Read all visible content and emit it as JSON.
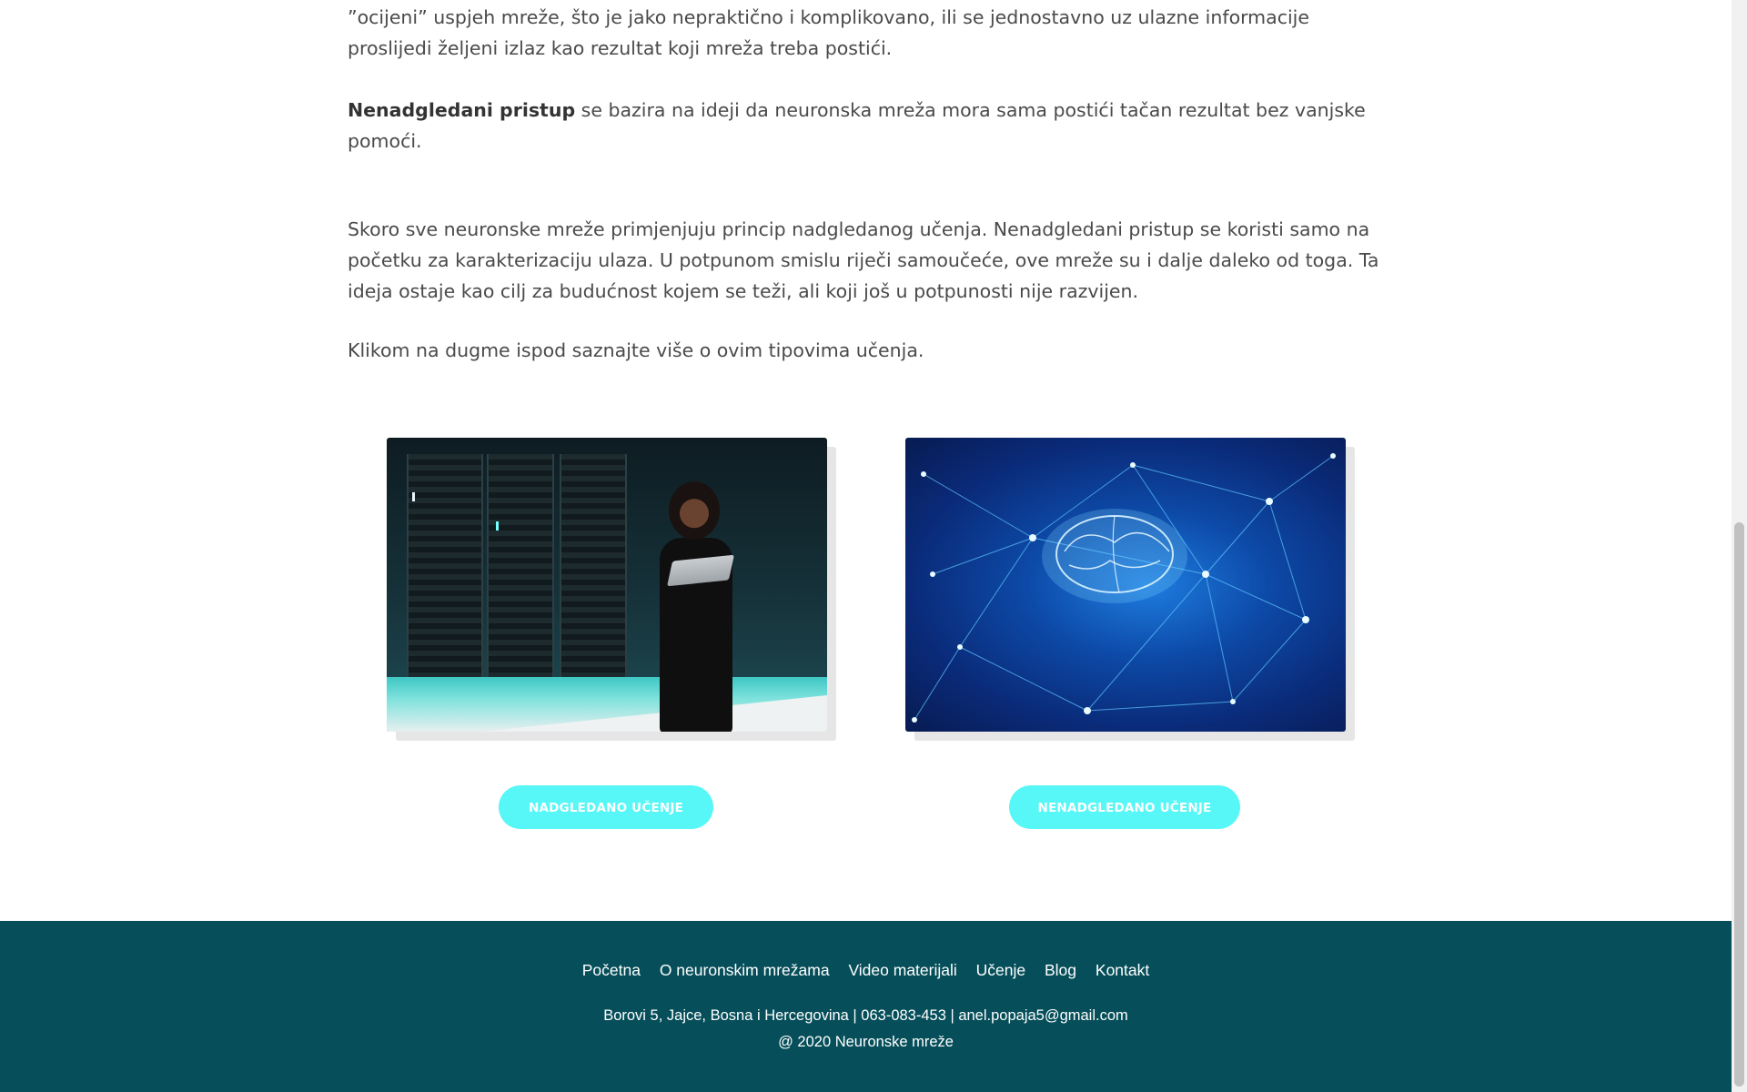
{
  "article": {
    "para1": "”ocijeni” uspjeh mreže, što je jako nepraktično i komplikovano, ili se jednostavno uz ulazne informacije proslijedi željeni izlaz kao rezultat koji mreža treba postići.",
    "para2_bold": "Nenadgledani pristup",
    "para2_rest": " se bazira na ideji da neuronska mreža mora sama postići tačan rezultat bez vanjske pomoći.",
    "para3": "Skoro sve neuronske mreže primjenjuju princip nadgledanog učenja. Nenadgledani pristup se koristi samo na početku za karakterizaciju ulaza. U potpunom smislu riječi samoučeće, ove mreže su i dalje daleko od toga. Ta ideja ostaje kao cilj za budućnost kojem se teži, ali koji još u potpunosti nije razvijen.",
    "para4": "Klikom na dugme ispod saznajte više o ovim tipovima učenja."
  },
  "buttons": {
    "supervised": "NADGLEDANO UČENJE",
    "unsupervised": "NENADGLEDANO UČENJE"
  },
  "colors": {
    "button_bg": "#57f7f7",
    "footer_bg": "#064f5a"
  },
  "footer": {
    "nav": [
      "Početna",
      "O neuronskim mrežama",
      "Video materijali",
      "Učenje",
      "Blog",
      "Kontakt"
    ],
    "contact": "Borovi 5, Jajce, Bosna i Hercegovina | 063-083-453 | anel.popaja5@gmail.com",
    "copyright": "@ 2020 Neuronske mreže"
  }
}
